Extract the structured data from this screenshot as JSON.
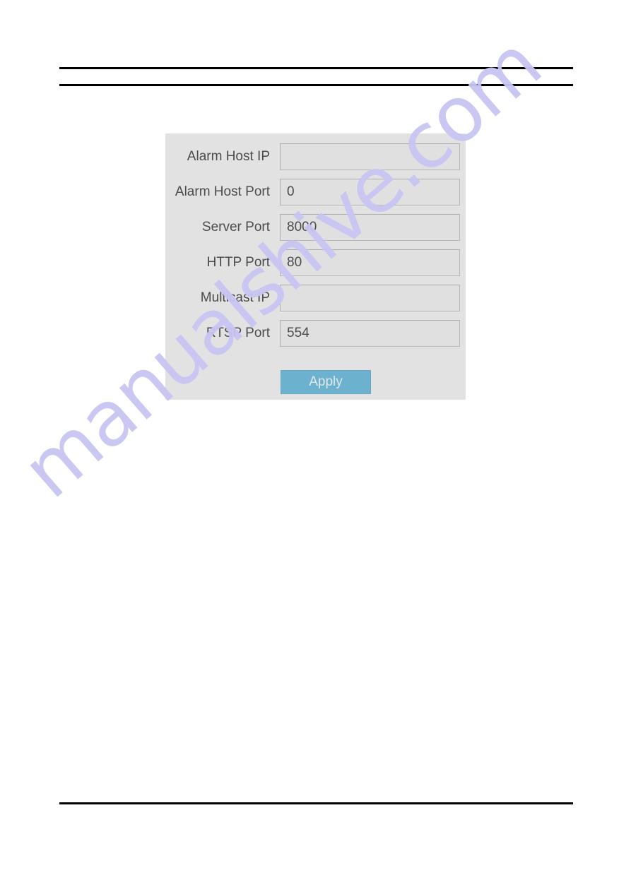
{
  "page": {
    "watermark_text": "manualshive.com",
    "watermark_color": "#c8c6f2",
    "background_color": "#ffffff"
  },
  "header": {
    "title": ""
  },
  "panel": {
    "background_color": "#e3e2e2",
    "rows": [
      {
        "label": "Alarm Host IP",
        "value": "",
        "placeholder": ""
      },
      {
        "label": "Alarm Host Port",
        "value": "0",
        "placeholder": ""
      },
      {
        "label": "Server Port",
        "value": "8000",
        "placeholder": ""
      },
      {
        "label": "HTTP Port",
        "value": "80",
        "placeholder": ""
      },
      {
        "label": "Multicast IP",
        "value": "",
        "placeholder": ""
      },
      {
        "label": "RTSP Port",
        "value": "554",
        "placeholder": ""
      }
    ],
    "apply_button": {
      "label": "Apply",
      "background_color": "#6cb2ce",
      "text_color": "#dfe9ee"
    }
  }
}
